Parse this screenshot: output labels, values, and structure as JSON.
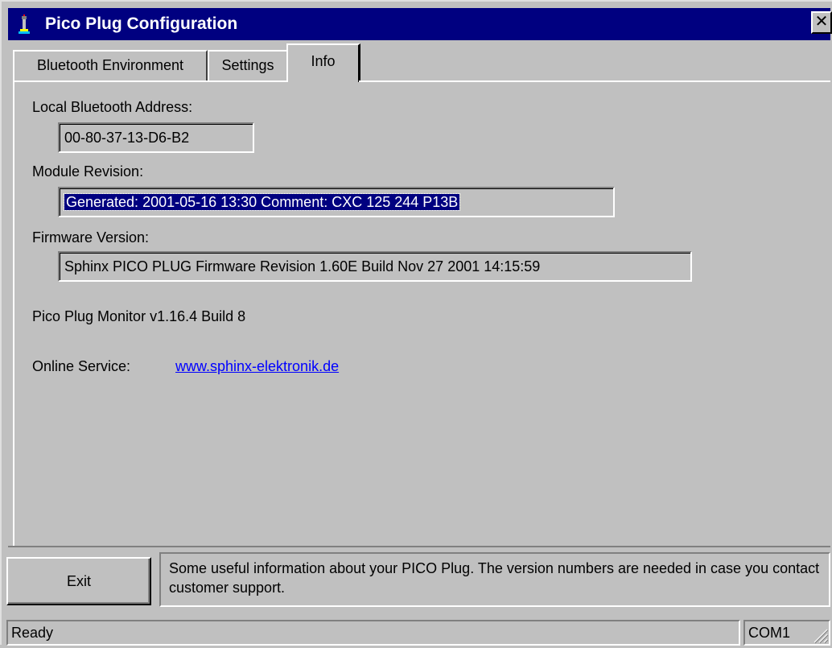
{
  "window": {
    "title": "Pico Plug Configuration",
    "close_glyph": "✕"
  },
  "tabs": [
    {
      "label": "Bluetooth Environment",
      "active": false
    },
    {
      "label": "Settings",
      "active": false
    },
    {
      "label": "Info",
      "active": true
    }
  ],
  "info": {
    "local_address_label": "Local Bluetooth Address:",
    "local_address_value": "00-80-37-13-D6-B2",
    "module_revision_label": "Module Revision:",
    "module_revision_value": "Generated: 2001-05-16 13:30 Comment: CXC 125 244 P13B",
    "firmware_label": "Firmware Version:",
    "firmware_value": "Sphinx PICO PLUG Firmware Revision 1.60E Build Nov 27 2001 14:15:59",
    "monitor_version": "Pico Plug Monitor v1.16.4 Build 8",
    "online_service_label": "Online Service:",
    "online_service_link": "www.sphinx-elektronik.de"
  },
  "footer": {
    "exit_label": "Exit",
    "description": "Some useful information about your PICO Plug. The version numbers are needed in case you contact customer support."
  },
  "statusbar": {
    "status": "Ready",
    "port": "COM1"
  },
  "colors": {
    "titlebar": "#000080",
    "face": "#c0c0c0",
    "link": "#0000ff",
    "selection": "#000080"
  },
  "icons": {
    "app_icon": "bluetooth-plug-icon",
    "close_icon": "close-icon",
    "grip_icon": "resize-grip-icon"
  }
}
